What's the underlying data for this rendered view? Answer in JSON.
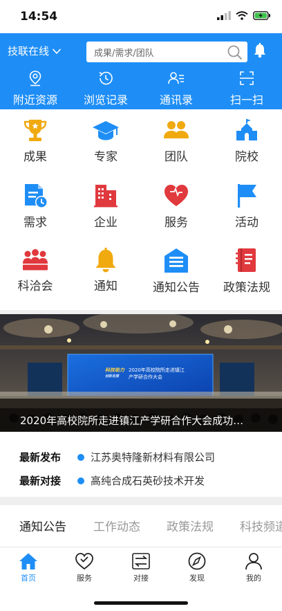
{
  "status": {
    "time": "14:54"
  },
  "header": {
    "location": "技联在线",
    "search_placeholder": "成果/需求/团队"
  },
  "quick_actions": [
    {
      "label": "附近资源",
      "icon": "location-pin-icon"
    },
    {
      "label": "浏览记录",
      "icon": "history-clock-icon"
    },
    {
      "label": "通讯录",
      "icon": "contacts-icon"
    },
    {
      "label": "扫一扫",
      "icon": "scan-icon"
    }
  ],
  "grid": [
    {
      "label": "成果",
      "icon": "trophy-icon",
      "color": "#f0a90f"
    },
    {
      "label": "专家",
      "icon": "graduation-cap-icon",
      "color": "#1e8ef6"
    },
    {
      "label": "团队",
      "icon": "team-icon",
      "color": "#f0a90f"
    },
    {
      "label": "院校",
      "icon": "campus-building-icon",
      "color": "#1e8ef6"
    },
    {
      "label": "需求",
      "icon": "document-clock-icon",
      "color": "#1e8ef6"
    },
    {
      "label": "企业",
      "icon": "enterprise-building-icon",
      "color": "#e0393e"
    },
    {
      "label": "服务",
      "icon": "heart-icon",
      "color": "#e0393e"
    },
    {
      "label": "活动",
      "icon": "flag-icon",
      "color": "#1e8ef6"
    },
    {
      "label": "科洽会",
      "icon": "audience-icon",
      "color": "#e0393e"
    },
    {
      "label": "通知",
      "icon": "bell-icon",
      "color": "#f0a90f"
    },
    {
      "label": "通知公告",
      "icon": "notice-board-icon",
      "color": "#1e8ef6"
    },
    {
      "label": "政策法规",
      "icon": "policy-book-icon",
      "color": "#e0393e"
    }
  ],
  "banner": {
    "caption": "2020年高校院所走进镇江产学研合作大会成功…",
    "screen_title_line1": "2020年高校院所走进镇江",
    "screen_title_line2": "产学研合作大会",
    "screen_logo_line1": "科技助力",
    "screen_logo_line2": "创新发展"
  },
  "news": [
    {
      "key": "最新发布",
      "value": "江苏奥特隆新材料有限公司"
    },
    {
      "key": "最新对接",
      "value": "高纯合成石英砂技术开发"
    }
  ],
  "tabs": [
    {
      "label": "通知公告",
      "active": true
    },
    {
      "label": "工作动态",
      "active": false
    },
    {
      "label": "政策法规",
      "active": false
    },
    {
      "label": "科技频道",
      "active": false
    }
  ],
  "bottom_nav": [
    {
      "label": "首页",
      "icon": "home-icon",
      "active": true
    },
    {
      "label": "服务",
      "icon": "heart-outline-icon",
      "active": false
    },
    {
      "label": "对接",
      "icon": "exchange-icon",
      "active": false
    },
    {
      "label": "发现",
      "icon": "compass-icon",
      "active": false
    },
    {
      "label": "我的",
      "icon": "user-icon",
      "active": false
    }
  ],
  "colors": {
    "primary": "#1e8ef6",
    "gold": "#f0a90f",
    "red": "#e0393e"
  }
}
